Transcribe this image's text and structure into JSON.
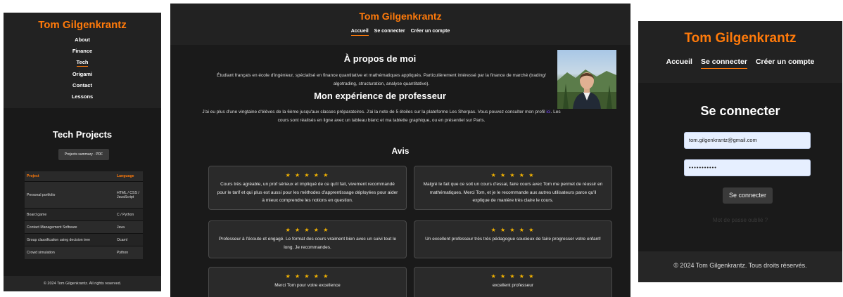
{
  "colors": {
    "accent": "#ff7a0a",
    "star": "#f5b400",
    "background": "#1a1a1a"
  },
  "tech_page": {
    "site_title": "Tom Gilgenkrantz",
    "nav": [
      "About",
      "Finance",
      "Tech",
      "Origami",
      "Contact",
      "Lessons"
    ],
    "active_nav": "Tech",
    "section_title": "Tech Projects",
    "pdf_button": "Projects summary · PDF",
    "table": {
      "headers": [
        "Project",
        "Language"
      ],
      "rows": [
        [
          "Personal portfolio",
          "HTML / CSS / JavaScript"
        ],
        [
          "Board game",
          "C / Python"
        ],
        [
          "Contact Management Software",
          "Java"
        ],
        [
          "Group classification using decision tree",
          "Ocaml"
        ],
        [
          "Crowd simulation",
          "Python"
        ]
      ]
    },
    "footer": "© 2024 Tom Gilgenkrantz. All rights reserved."
  },
  "home_page": {
    "site_title": "Tom Gilgenkrantz",
    "nav": [
      "Accueil",
      "Se connecter",
      "Créer un compte"
    ],
    "active_nav": "Accueil",
    "about_title": "À propos de moi",
    "about_text": "Étudiant français en école d'ingénieur, spécialisé en finance quantitative et mathématiques appliqués. Particulièrement intéressé par la finance de marché (trading/ algotrading, structuration, analyse quantitative).",
    "experience_title": "Mon expérience de professeur",
    "experience_text_before": "J'ai eu plus d'une vingtaine d'élèves de la 6ème jusqu'aux classes préparatoires. J'ai la note de 5 étoiles sur la plateforme Les Sherpas. Vous pouvez consulter mon profil",
    "experience_link_glyph": "ici",
    "experience_text_after": ". Les cours sont réalisés en ligne avec un tableau blanc et ma tablette graphique, ou en présentiel sur Paris.",
    "reviews_title": "Avis",
    "reviews": [
      {
        "stars": "★ ★ ★ ★ ★",
        "text": "Cours très agréable, un prof sérieux et impliqué de ce qu'il fait, vivement recommandé pour le tarif et qui plus est aussi pour les méthodes d'apprentissage déployées pour aider à mieux comprendre les notions en question."
      },
      {
        "stars": "★ ★ ★ ★ ★",
        "text": "Malgré le fait que ce soit un cours d'essai, faire cours avec Tom me permet de réussir en mathématiques. Merci Tom, et je le recommande aux autres utilisateurs parce qu'il explique de manière très claire le cours."
      },
      {
        "stars": "★ ★ ★ ★ ★",
        "text": "Professeur à l'écoute et engagé. Le format des cours vraiment bien avec un suivi tout le long. Je recommandes."
      },
      {
        "stars": "★ ★ ★ ★ ★",
        "text": "Un excellent professeur très très pédagogue soucieux de faire progresser votre enfant!"
      },
      {
        "stars": "★ ★ ★ ★ ★",
        "text": "Merci Tom pour votre excellence"
      },
      {
        "stars": "★ ★ ★ ★ ★",
        "text": "excellent professeur"
      }
    ]
  },
  "login_page": {
    "site_title": "Tom Gilgenkrantz",
    "nav": [
      "Accueil",
      "Se connecter",
      "Créer un compte"
    ],
    "active_nav": "Se connecter",
    "title": "Se connecter",
    "email_value": "tom.gilgenkrantz@gmail.com",
    "password_value": "•••••••••••",
    "submit_label": "Se connecter",
    "forgot_link": "Mot de passe oublié ?",
    "footer": "© 2024 Tom Gilgenkrantz. Tous droits réservés."
  }
}
